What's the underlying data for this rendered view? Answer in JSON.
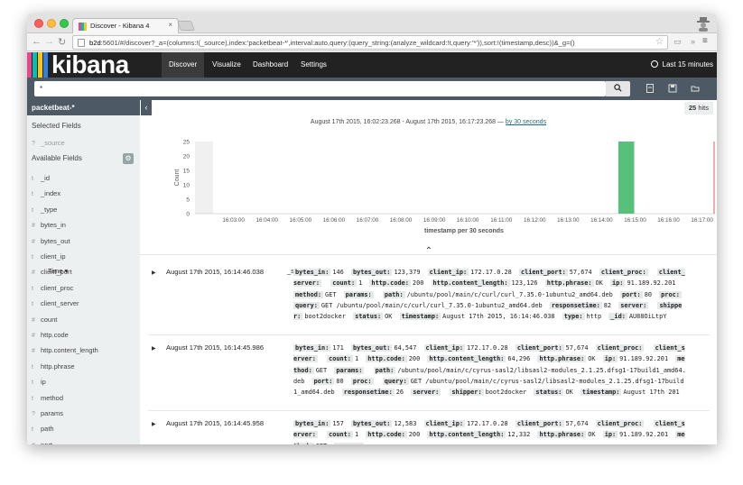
{
  "browser": {
    "tab_title": "Discover - Kibana 4",
    "tab_close": "×",
    "url_host": "b2d",
    "url_rest": ":5601/#/discover?_a=(columns:!(_source),index:'packetbeat-*',interval:auto,query:(query_string:(analyze_wildcard:!t,query:'*')),sort:!(timestamp,desc))&_g=()",
    "star": "☆",
    "more": "»",
    "menu": "≡"
  },
  "app": {
    "logo": "kibana",
    "logo_colors": [
      "#e8478b",
      "#00bfb3",
      "#fec514",
      "#2d80e5"
    ],
    "nav": [
      "Discover",
      "Visualize",
      "Dashboard",
      "Settings"
    ],
    "time_range": "Last 15 minutes"
  },
  "search": {
    "query": "*",
    "search_icon": "search-icon"
  },
  "sidebar": {
    "index_pattern": "packetbeat-*",
    "selected_fields_label": "Selected Fields",
    "selected_fields": [
      {
        "type": "?",
        "name": "_source"
      }
    ],
    "available_fields_label": "Available Fields",
    "fields": [
      {
        "type": "t",
        "name": "_id"
      },
      {
        "type": "t",
        "name": "_index"
      },
      {
        "type": "t",
        "name": "_type"
      },
      {
        "type": "#",
        "name": "bytes_in"
      },
      {
        "type": "#",
        "name": "bytes_out"
      },
      {
        "type": "t",
        "name": "client_ip"
      },
      {
        "type": "#",
        "name": "client_port"
      },
      {
        "type": "t",
        "name": "client_proc"
      },
      {
        "type": "t",
        "name": "client_server"
      },
      {
        "type": "#",
        "name": "count"
      },
      {
        "type": "#",
        "name": "http.code"
      },
      {
        "type": "#",
        "name": "http.content_length"
      },
      {
        "type": "t",
        "name": "http.phrase"
      },
      {
        "type": "t",
        "name": "ip"
      },
      {
        "type": "t",
        "name": "method"
      },
      {
        "type": "?",
        "name": "params"
      },
      {
        "type": "t",
        "name": "path"
      },
      {
        "type": "#",
        "name": "port"
      }
    ]
  },
  "results": {
    "hits": "25",
    "hits_label": "hits",
    "range_text": "August 17th 2015, 16:02:23.268 - August 17th 2015, 16:17:23.268 —",
    "interval_link": "by 30 seconds",
    "col_time": "Time",
    "col_source": "_source",
    "rows": [
      {
        "time": "August 17th 2015, 16:14:46.038",
        "pairs": [
          [
            "bytes_in:",
            "146"
          ],
          [
            "bytes_out:",
            "123,379"
          ],
          [
            "client_ip:",
            "172.17.0.28"
          ],
          [
            "client_port:",
            "57,674"
          ],
          [
            "client_proc:",
            ""
          ],
          [
            "client_server:",
            ""
          ],
          [
            "count:",
            "1"
          ],
          [
            "http.code:",
            "200"
          ],
          [
            "http.content_length:",
            "123,126"
          ],
          [
            "http.phrase:",
            "OK"
          ],
          [
            "ip:",
            "91.189.92.201"
          ],
          [
            "method:",
            "GET"
          ],
          [
            "params:",
            ""
          ],
          [
            "path:",
            "/ubuntu/pool/main/c/curl/curl_7.35.0-1ubuntu2_amd64.deb"
          ],
          [
            "port:",
            "80"
          ],
          [
            "proc:",
            ""
          ],
          [
            "query:",
            "GET /ubuntu/pool/main/c/curl/curl_7.35.0-1ubuntu2_amd64.deb"
          ],
          [
            "responsetime:",
            "82"
          ],
          [
            "server:",
            ""
          ],
          [
            "shipper:",
            "boot2docker"
          ],
          [
            "status:",
            "OK"
          ],
          [
            "timestamp:",
            "August 17th 2015, 16:14:46.038"
          ],
          [
            "type:",
            "http"
          ],
          [
            "_id:",
            "AU88OiLtpY"
          ]
        ]
      },
      {
        "time": "August 17th 2015, 16:14:45.986",
        "pairs": [
          [
            "bytes_in:",
            "171"
          ],
          [
            "bytes_out:",
            "64,547"
          ],
          [
            "client_ip:",
            "172.17.0.28"
          ],
          [
            "client_port:",
            "57,674"
          ],
          [
            "client_proc:",
            ""
          ],
          [
            "client_server:",
            ""
          ],
          [
            "count:",
            "1"
          ],
          [
            "http.code:",
            "200"
          ],
          [
            "http.content_length:",
            "64,296"
          ],
          [
            "http.phrase:",
            "OK"
          ],
          [
            "ip:",
            "91.189.92.201"
          ],
          [
            "method:",
            "GET"
          ],
          [
            "params:",
            ""
          ],
          [
            "path:",
            "/ubuntu/pool/main/c/cyrus-sasl2/libsasl2-modules_2.1.25.dfsg1-17build1_amd64.deb"
          ],
          [
            "port:",
            "80"
          ],
          [
            "proc:",
            ""
          ],
          [
            "query:",
            "GET /ubuntu/pool/main/c/cyrus-sasl2/libsasl2-modules_2.1.25.dfsg1-17build1_amd64.deb"
          ],
          [
            "responsetime:",
            "26"
          ],
          [
            "server:",
            ""
          ],
          [
            "shipper:",
            "boot2docker"
          ],
          [
            "status:",
            "OK"
          ],
          [
            "timestamp:",
            "August 17th 201"
          ]
        ]
      },
      {
        "time": "August 17th 2015, 16:14:45.958",
        "pairs": [
          [
            "bytes_in:",
            "157"
          ],
          [
            "bytes_out:",
            "12,583"
          ],
          [
            "client_ip:",
            "172.17.0.28"
          ],
          [
            "client_port:",
            "57,674"
          ],
          [
            "client_proc:",
            ""
          ],
          [
            "client_server:",
            ""
          ],
          [
            "count:",
            "1"
          ],
          [
            "http.code:",
            "200"
          ],
          [
            "http.content_length:",
            "12,332"
          ],
          [
            "http.phrase:",
            "OK"
          ],
          [
            "ip:",
            "91.189.92.201"
          ],
          [
            "method:",
            "GET"
          ],
          [
            "params:",
            ""
          ]
        ]
      }
    ]
  },
  "chart_data": {
    "type": "bar",
    "title": "",
    "xlabel": "timestamp per 30 seconds",
    "ylabel": "Count",
    "ylim": [
      0,
      25
    ],
    "yticks": [
      0,
      5,
      10,
      15,
      20,
      25
    ],
    "xticks": [
      "16:03:00",
      "16:04:00",
      "16:05:00",
      "16:06:00",
      "16:07:00",
      "16:08:00",
      "16:09:00",
      "16:10:00",
      "16:11:00",
      "16:12:00",
      "16:13:00",
      "16:14:00",
      "16:15:00",
      "16:16:00",
      "16:17:00"
    ],
    "bars": [
      {
        "x": "16:14:30",
        "value": 25
      }
    ],
    "bar_color": "#57c17b",
    "now_line_color": "#e45b5b"
  }
}
